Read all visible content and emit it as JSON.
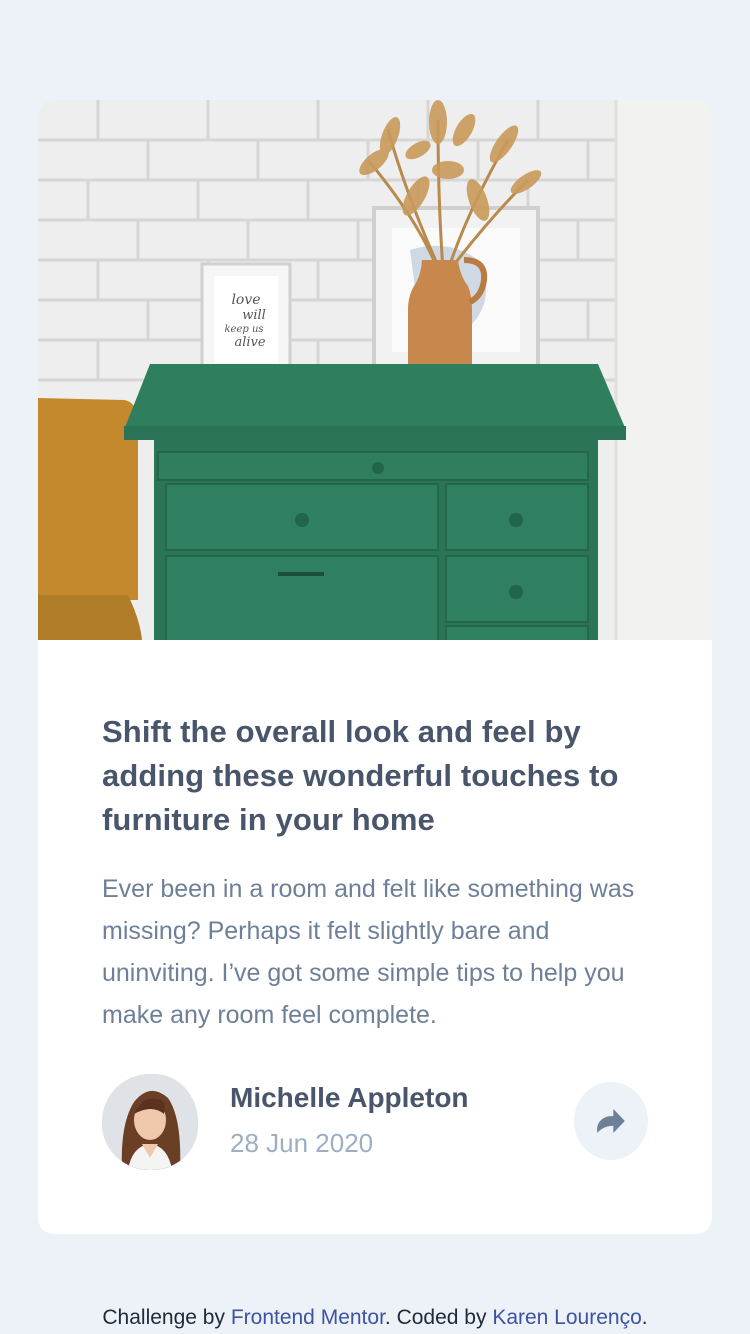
{
  "article": {
    "title": "Shift the overall look and feel by adding these wonderful touches to furniture in your home",
    "excerpt": "Ever been in a room and felt like something was missing? Perhaps it felt slightly bare and uninviting. I’ve got some simple tips to help you make any room feel complete.",
    "hero_image": "green-drawers-photo",
    "frame_text": [
      "love",
      "will",
      "keep us",
      "alive"
    ]
  },
  "author": {
    "name": "Michelle Appleton",
    "date": "28 Jun 2020",
    "avatar": "avatar-photo"
  },
  "share": {
    "icon": "share-icon"
  },
  "attribution": {
    "prefix": "Challenge by ",
    "mentor_link": "Frontend Mentor",
    "middle": ". Coded by ",
    "coder_link": "Karen Lourenço",
    "suffix": "."
  },
  "colors": {
    "page_bg": "#ecf2f8",
    "card_bg": "#ffffff",
    "title": "#48556a",
    "body": "#6e8098",
    "muted": "#9daec2",
    "link": "#3e52a3"
  }
}
